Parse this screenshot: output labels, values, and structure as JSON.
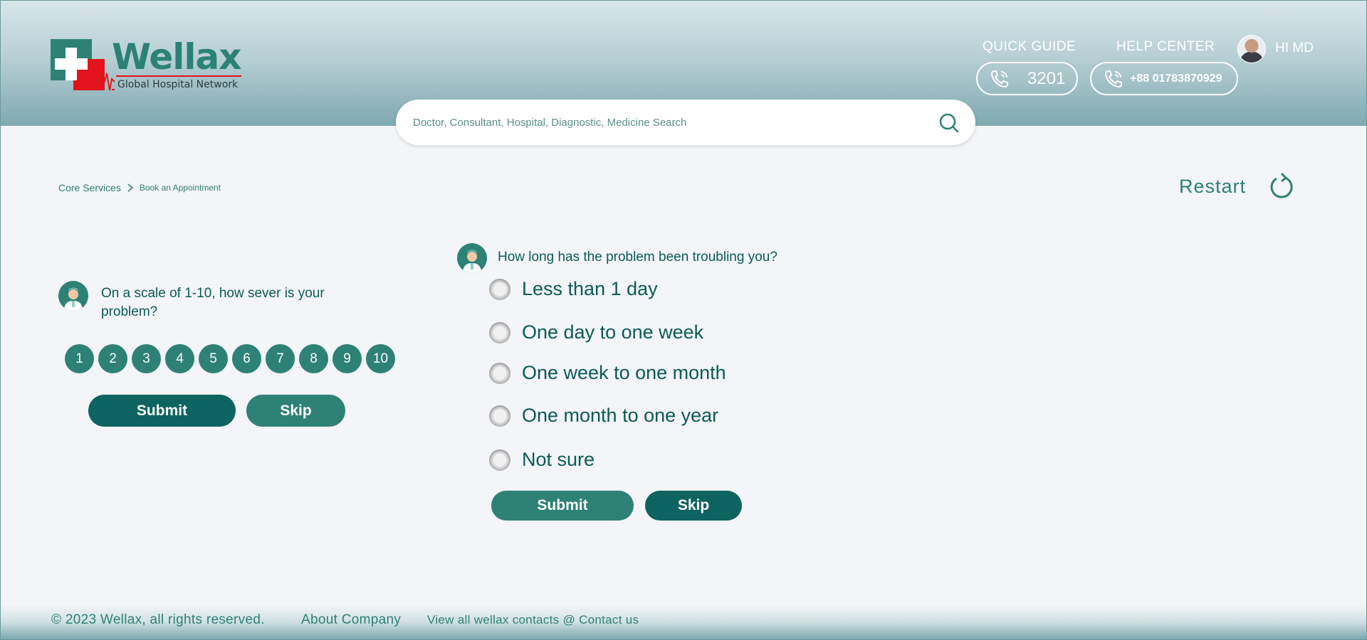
{
  "colors": {
    "primary": "#2e8175",
    "primary_dark": "#0d6360",
    "text_dark": "#0b5a57",
    "background": "#f3f5f8",
    "logo_red": "#e2131d"
  },
  "header": {
    "logo": {
      "title": "Wellax",
      "subtitle": "Global Hospital Network"
    },
    "quick_guide": {
      "label": "QUICK GUIDE",
      "number": "3201"
    },
    "help_center": {
      "label": "HELP CENTER",
      "number": "+88 01783870929"
    },
    "user": {
      "greeting": "HI MD"
    },
    "search": {
      "placeholder": "Doctor, Consultant, Hospital, Diagnostic, Medicine Search"
    }
  },
  "breadcrumb": {
    "items": [
      "Core Services",
      "Book an Appointment"
    ]
  },
  "restart": {
    "label": "Restart"
  },
  "question_severity": {
    "text": "On a scale of 1-10, how sever is your problem?",
    "scale": [
      "1",
      "2",
      "3",
      "4",
      "5",
      "6",
      "7",
      "8",
      "9",
      "10"
    ],
    "submit_label": "Submit",
    "skip_label": "Skip"
  },
  "question_duration": {
    "text": "How long has the problem been troubling you?",
    "options": [
      "Less than 1 day",
      "One day to one week",
      "One week to one month",
      "One month to one year",
      "Not sure"
    ],
    "submit_label": "Submit",
    "skip_label": "Skip"
  },
  "footer": {
    "copyright": "© 2023 Wellax, all rights reserved.",
    "about": "About Company",
    "contacts": "View all wellax contacts @ Contact us"
  },
  "icons": [
    "phone-icon",
    "search-icon",
    "restart-icon",
    "doctor-avatar-icon",
    "user-avatar",
    "hospital-cross-logo"
  ]
}
